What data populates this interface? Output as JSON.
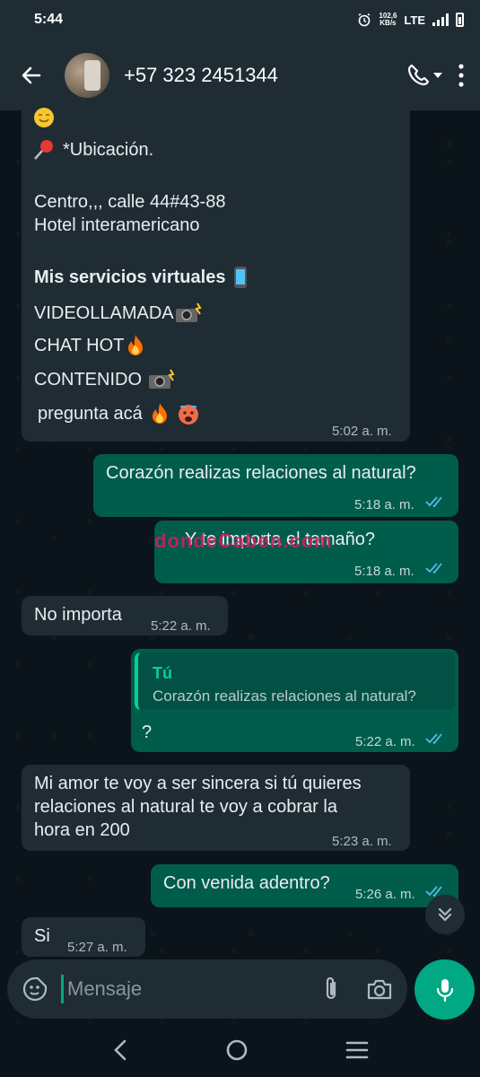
{
  "status_bar": {
    "time": "5:44",
    "net_speed_value": "102,6",
    "net_speed_unit": "KB/s",
    "network": "LTE"
  },
  "header": {
    "contact": "+57 323 2451344"
  },
  "messages": {
    "m1": {
      "line_location": "*Ubicación.",
      "line_address": "Centro,,, calle 44#43-88",
      "line_hotel": "Hotel interamericano",
      "line_services": "Mis servicios virtuales",
      "line_video": "VIDEOLLAMADA",
      "line_chat": "CHAT HOT",
      "line_content": "CONTENIDO",
      "line_ask": "pregunta acá",
      "time": "5:02 a. m."
    },
    "m2": {
      "text": "Corazón realizas relaciones al natural?",
      "time": "5:18 a. m."
    },
    "m3": {
      "text": "Y te importa el tamaño?",
      "overlay": "dondeCaben.com",
      "time": "5:18 a. m."
    },
    "m4": {
      "text": "No importa",
      "time": "5:22 a. m."
    },
    "m5": {
      "quote_author": "Tú",
      "quote_text": "Corazón realizas relaciones al natural?",
      "text": "?",
      "time": "5:22 a. m."
    },
    "m6": {
      "line1": "Mi amor te voy a ser sincera si tú quieres",
      "line2": "relaciones al natural te voy a cobrar la",
      "line3": "hora en 200",
      "time": "5:23 a. m."
    },
    "m7": {
      "text": "Con venida adentro?",
      "time": "5:26 a. m."
    },
    "m8": {
      "text": "Si",
      "time": "5:27 a. m."
    }
  },
  "input": {
    "placeholder": "Mensaje"
  },
  "colors": {
    "incoming": "#1f2c34",
    "outgoing": "#005c4b",
    "accent": "#00a884",
    "read_ticks": "#53bdeb"
  }
}
